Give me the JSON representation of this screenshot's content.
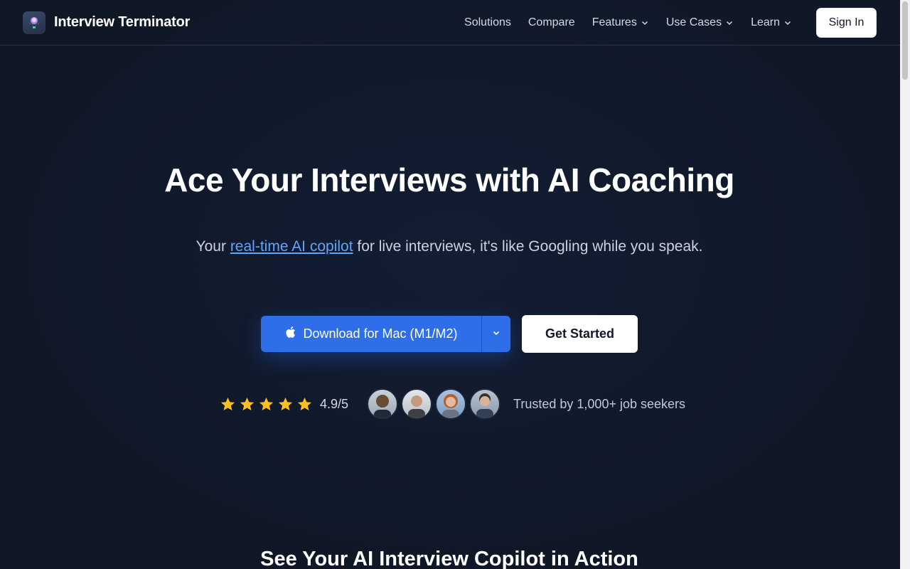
{
  "header": {
    "brand": "Interview Terminator",
    "nav": [
      {
        "label": "Solutions",
        "has_dropdown": false
      },
      {
        "label": "Compare",
        "has_dropdown": false
      },
      {
        "label": "Features",
        "has_dropdown": true
      },
      {
        "label": "Use Cases",
        "has_dropdown": true
      },
      {
        "label": "Learn",
        "has_dropdown": true
      }
    ],
    "sign_in": "Sign In"
  },
  "hero": {
    "title": "Ace Your Interviews with AI Coaching",
    "subtitle_prefix": "Your",
    "subtitle_link": "real-time AI copilot",
    "subtitle_suffix": "for live interviews, it's like Googling while you speak.",
    "download_button": "Download for Mac (M1/M2)",
    "get_started_button": "Get Started",
    "rating_stars": 5,
    "rating": "4.9/5",
    "trust_text": "Trusted by 1,000+ job seekers"
  },
  "next_section_title": "See Your AI Interview Copilot in Action",
  "colors": {
    "background": "#111a2e",
    "accent": "#2f6ee9",
    "link": "#60a5fa",
    "star": "#fbbf24"
  },
  "icons": [
    "logo-icon",
    "chevron-down-icon",
    "apple-icon",
    "star-icon",
    "avatar"
  ]
}
